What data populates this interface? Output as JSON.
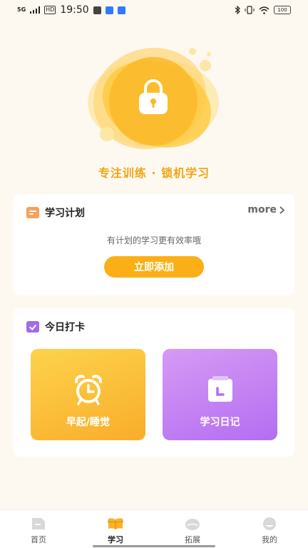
{
  "status_bar": {
    "signal": "5G",
    "hd": "HD",
    "time": "19:50",
    "battery": "100"
  },
  "hero": {
    "tagline": "专注训练 · 锁机学习",
    "colors": {
      "accent": "#f3a316",
      "blob": "#fcc83a"
    }
  },
  "plan": {
    "title": "学习计划",
    "more_label": "more",
    "hint": "有计划的学习更有效率哦",
    "add_label": "立即添加"
  },
  "checkin": {
    "title": "今日打卡",
    "tiles": [
      {
        "label": "早起/睡觉",
        "icon": "alarm-clock-icon"
      },
      {
        "label": "学习日记",
        "icon": "calendar-clock-icon"
      }
    ]
  },
  "tabs": [
    {
      "label": "首页",
      "icon": "home-doc-icon",
      "active": false
    },
    {
      "label": "学习",
      "icon": "open-book-icon",
      "active": true
    },
    {
      "label": "拓展",
      "icon": "explore-icon",
      "active": false
    },
    {
      "label": "我的",
      "icon": "profile-face-icon",
      "active": false
    }
  ]
}
